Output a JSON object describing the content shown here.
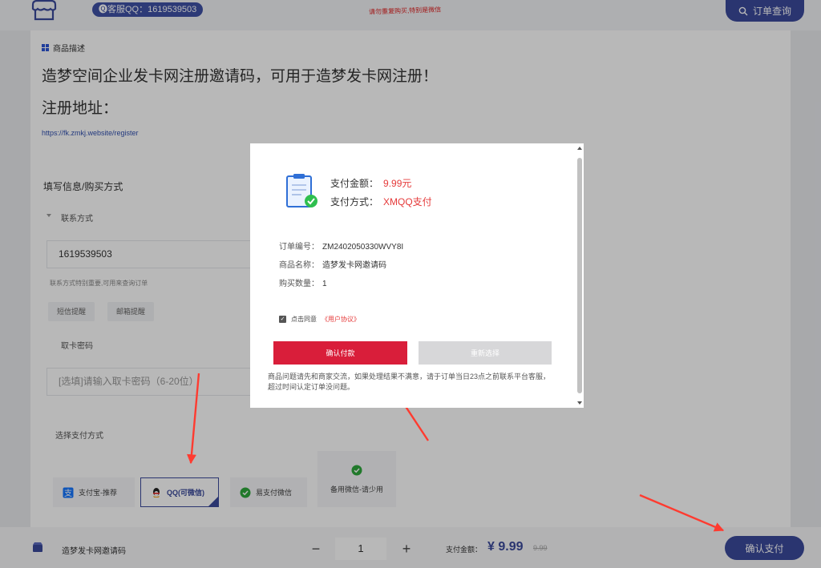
{
  "header": {
    "qq_label": "🅠客服QQ：1619539503",
    "notice": "请勿重复购买,特别是微信",
    "order_query": "订单查询"
  },
  "product": {
    "desc_heading": "商品描述",
    "title_line1": "造梦空间企业发卡网注册邀请码，可用于造梦发卡网注册！",
    "title_line2": "注册地址：",
    "url": "https://fk.zmkj.website/register"
  },
  "form": {
    "section_title": "填写信息/购买方式",
    "contact_label": "联系方式",
    "contact_value": "1619539503",
    "contact_hint": "联系方式特别重要,可用来查询订单",
    "sms_remind": "短信提醒",
    "email_remind": "邮箱提醒",
    "card_pwd_label": "取卡密码",
    "card_pwd_placeholder": "[选填]请输入取卡密码（6-20位）",
    "pay_method_label": "选择支付方式",
    "pay_methods": [
      "支付宝-推荐",
      "QQ(可微信)",
      "易支付微信",
      "备用微信-请少用"
    ]
  },
  "bottom_bar": {
    "product_name": "造梦发卡网邀请码",
    "minus": "−",
    "quantity": "1",
    "plus": "+",
    "total_label": "支付金额：",
    "total_value": "¥ 9.99",
    "original_price": "9.99",
    "confirm_pay": "确认支付"
  },
  "modal": {
    "amount_label": "支付金额：",
    "amount_value": "9.99元",
    "method_label": "支付方式：",
    "method_value": "XMQQ支付",
    "order_no_label": "订单编号：",
    "order_no_value": "ZM2402050330WVY8I",
    "product_label": "商品名称：",
    "product_value": "造梦发卡网邀请码",
    "qty_label": "购买数量：",
    "qty_value": "1",
    "agree_text": "点击同意",
    "agree_link": "《用户协议》",
    "confirm_btn": "确认付款",
    "reselect_btn": "重新选择",
    "note": "商品问题请先和商家交流，如果处理结果不满意，请于订单当日23点之前联系平台客服，超过时间认定订单没问题。"
  },
  "colors": {
    "brand": "#3b4a9b",
    "danger": "#d91e3a",
    "price_red": "#e53a3a",
    "annotation_arrow": "#ff3b30"
  }
}
